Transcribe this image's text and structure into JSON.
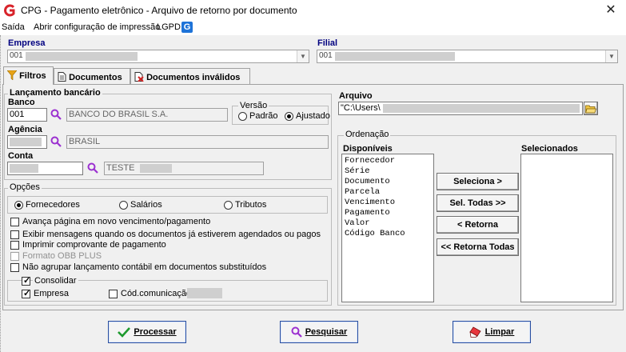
{
  "window": {
    "title": "CPG - Pagamento eletrônico - Arquivo de retorno por documento",
    "close_glyph": "✕"
  },
  "menu": {
    "items": [
      "Saída",
      "Abrir configuração de impressão",
      "LGPD"
    ],
    "lgpd_icon_letter": "G"
  },
  "empresa": {
    "label": "Empresa",
    "value": "001"
  },
  "filial": {
    "label": "Filial",
    "value": "001"
  },
  "tabs": [
    {
      "label": "Filtros",
      "icon": "filter-icon"
    },
    {
      "label": "Documentos",
      "icon": "document-icon"
    },
    {
      "label": "Documentos inválidos",
      "icon": "invalid-document-icon"
    }
  ],
  "lancamento": {
    "title": "Lançamento bancário",
    "banco_label": "Banco",
    "banco_code": "001",
    "banco_name": "BANCO DO BRASIL S.A.",
    "versao_title": "Versão",
    "versao_options": [
      "Padrão",
      "Ajustado"
    ],
    "versao_selected": "Ajustado",
    "agencia_label": "Agência",
    "agencia_name": "BRASIL",
    "conta_label": "Conta",
    "conta_name": "TESTE"
  },
  "opcoes": {
    "title": "Opções",
    "tipo_options": [
      "Fornecedores",
      "Salários",
      "Tributos"
    ],
    "tipo_selected": "Fornecedores",
    "checks": [
      {
        "label": "Avança página em novo vencimento/pagamento",
        "checked": false,
        "enabled": true
      },
      {
        "label": "Exibir mensagens quando os documentos já estiverem agendados ou pagos",
        "checked": false,
        "enabled": true
      },
      {
        "label": "Imprimir comprovante de pagamento",
        "checked": false,
        "enabled": true
      },
      {
        "label": "Formato OBB PLUS",
        "checked": false,
        "enabled": false
      },
      {
        "label": "Não agrupar lançamento contábil em documentos substituídos",
        "checked": false,
        "enabled": true
      }
    ],
    "consolidar": {
      "label": "Consolidar",
      "checked": true
    },
    "empresa_cb": {
      "label": "Empresa",
      "checked": true
    },
    "cod_comunicacao": {
      "label": "Cód.comunicação",
      "checked": false
    }
  },
  "arquivo": {
    "label": "Arquivo",
    "value": "\"C:\\Users\\"
  },
  "ordenacao": {
    "title": "Ordenação",
    "disponiveis_label": "Disponíveis",
    "selecionados_label": "Selecionados",
    "disponiveis": [
      "Fornecedor",
      "Série",
      "Documento",
      "Parcela",
      "Vencimento",
      "Pagamento",
      "Valor",
      "Código Banco"
    ],
    "selecionados": [],
    "buttons": [
      "Seleciona >",
      "Sel. Todas >>",
      "< Retorna",
      "<< Retorna Todas"
    ]
  },
  "actions": {
    "processar": "Processar",
    "pesquisar": "Pesquisar",
    "limpar": "Limpar"
  },
  "colors": {
    "accent_blue": "#000080",
    "app_red": "#d8232a",
    "lookup_purple": "#9b30d0"
  }
}
